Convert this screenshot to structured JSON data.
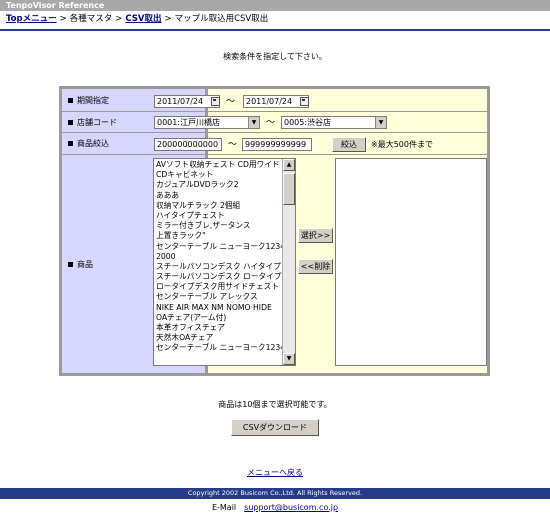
{
  "title": "TenpoVisor Reference",
  "breadcrumb": {
    "top": "Topメニュー",
    "sep": ">",
    "master": "各種マスタ",
    "csv": "CSV取出",
    "current": "マップル取込用CSV取出"
  },
  "instruction": "検索条件を指定して下さい。",
  "form": {
    "period": {
      "label": "期間指定",
      "from": "2011/07/24",
      "to": "2011/07/24",
      "tilde": "〜"
    },
    "store": {
      "label": "店舗コード",
      "from": "0001:江戸川橋店",
      "to": "0005:渋谷店",
      "tilde": "〜"
    },
    "product_filter": {
      "label": "商品絞込",
      "from": "200000000000",
      "to": "999999999999",
      "tilde": "〜",
      "button": "絞込",
      "note": "※最大500件まで"
    },
    "products": {
      "label": "商品",
      "items": [
        "AVソフト収納チェスト CD用ワイド",
        "CDキャビネット",
        "カジュアルDVDラック2",
        "あああ",
        "収納マルチラック 2個組",
        "ハイタイプチェスト",
        "ミラー付きブレ,ザータンス",
        "上置きラック\"",
        "センターテーブル ニューヨーク123456",
        "2000",
        "スチールパソコンデスク ハイタイプ",
        "スチールパソコンデスク ロータイプ",
        "ロータイプデスク用サイドチェスト",
        "センターテーブル アレックス",
        "NIKE AIR MAX NM NOMO HIDE",
        "OAチェア(アーム付)",
        "本革オフィスチェア",
        "天然木OAチェア",
        "センターテーブル ニューヨーク123456"
      ],
      "select_button": "選択>>",
      "delete_button": "<<削除"
    }
  },
  "limit_note": "商品は10個まで選択可能です。",
  "download_button": "CSVダウンロード",
  "back_link": "メニューへ戻る",
  "footer": "Copyright 2002 Busicom Co.,Ltd. All Rights Reserved.",
  "email": {
    "label": "E-Mail",
    "address": "support@busicom.co.jp"
  },
  "colors": {
    "titlebar": "#a9a9a9",
    "label_bg": "#d6d6ff",
    "value_bg": "#ffffd9",
    "footer_bg": "#283a8c",
    "link": "#000080"
  }
}
